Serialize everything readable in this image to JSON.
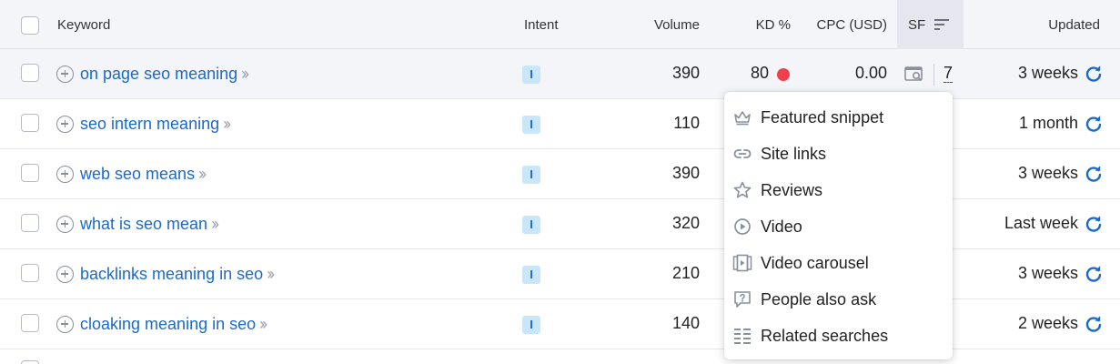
{
  "header": {
    "keyword": "Keyword",
    "intent": "Intent",
    "volume": "Volume",
    "kd": "KD %",
    "cpc": "CPC (USD)",
    "sf": "SF",
    "updated": "Updated"
  },
  "rows": [
    {
      "keyword": "on page seo meaning",
      "intent": "I",
      "volume": "390",
      "kd": "80",
      "cpc": "0.00",
      "sf": "7",
      "updated": "3 weeks"
    },
    {
      "keyword": "seo intern meaning",
      "intent": "I",
      "volume": "110",
      "updated": "1 month"
    },
    {
      "keyword": "web seo means",
      "intent": "I",
      "volume": "390",
      "updated": "3 weeks"
    },
    {
      "keyword": "what is seo mean",
      "intent": "I",
      "volume": "320",
      "updated": "Last week"
    },
    {
      "keyword": "backlinks meaning in seo",
      "intent": "I",
      "volume": "210",
      "updated": "3 weeks"
    },
    {
      "keyword": "cloaking meaning in seo",
      "intent": "I",
      "volume": "140",
      "updated": "2 weeks"
    }
  ],
  "serp_features": [
    {
      "label": "Featured snippet",
      "icon": "crown-icon"
    },
    {
      "label": "Site links",
      "icon": "link-icon"
    },
    {
      "label": "Reviews",
      "icon": "star-icon"
    },
    {
      "label": "Video",
      "icon": "play-icon"
    },
    {
      "label": "Video carousel",
      "icon": "video-carousel-icon"
    },
    {
      "label": "People also ask",
      "icon": "question-icon"
    },
    {
      "label": "Related searches",
      "icon": "list-icon"
    }
  ],
  "colors": {
    "link": "#1b6ac9",
    "kd_hard": "#ef3f4c",
    "intent_bg": "#c9e6fb",
    "header_bg": "#f4f5f9"
  }
}
